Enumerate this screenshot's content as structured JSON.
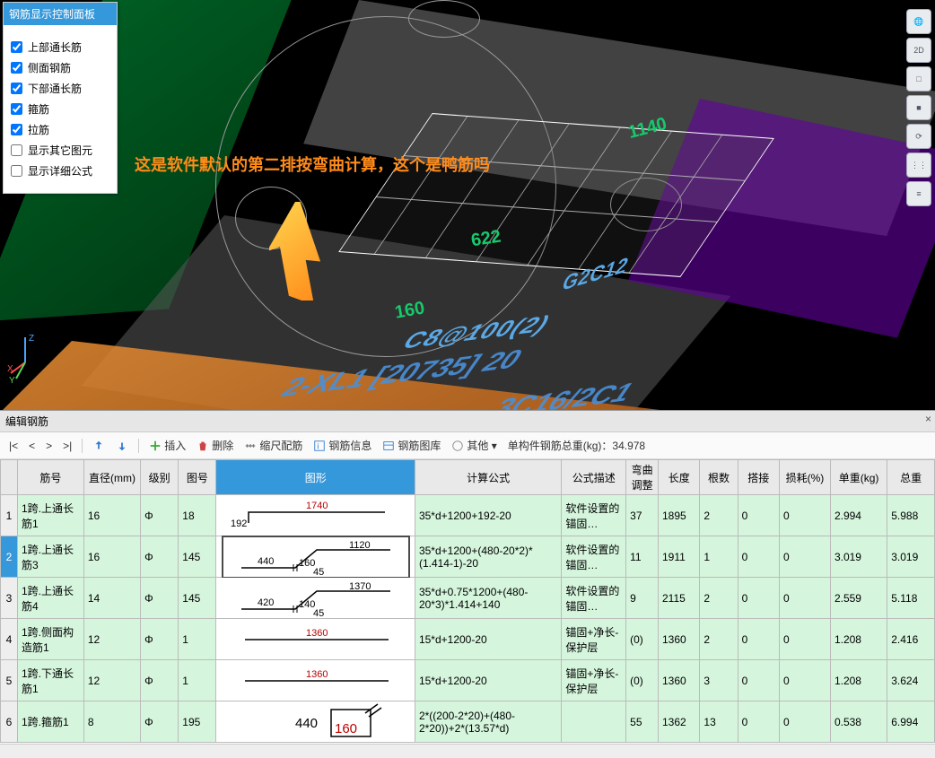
{
  "panel": {
    "title": "钢筋显示控制面板",
    "checks": [
      {
        "label": "上部通长筋",
        "checked": true
      },
      {
        "label": "侧面钢筋",
        "checked": true
      },
      {
        "label": "下部通长筋",
        "checked": true
      },
      {
        "label": "箍筋",
        "checked": true
      },
      {
        "label": "拉筋",
        "checked": true
      },
      {
        "label": "显示其它图元",
        "checked": false
      },
      {
        "label": "显示详细公式",
        "checked": false
      }
    ]
  },
  "right_tools": [
    {
      "name": "orbit-icon",
      "glyph": "🌐"
    },
    {
      "name": "view-2d-icon",
      "glyph": "2D"
    },
    {
      "name": "cube-wire-icon",
      "glyph": "□"
    },
    {
      "name": "cube-solid-icon",
      "glyph": "■"
    },
    {
      "name": "rotate-icon",
      "glyph": "⟳"
    },
    {
      "name": "tool-a-icon",
      "glyph": "⋮⋮"
    },
    {
      "name": "tool-b-icon",
      "glyph": "≡"
    }
  ],
  "axes": {
    "x": "X",
    "y": "Y",
    "z": "Z"
  },
  "scene": {
    "annotation": "这是软件默认的第二排按弯曲计算，这个是鸭筋吗",
    "dim1": "1140",
    "dim2": "622",
    "dim3": "160",
    "labelA": "C8@100(2)",
    "labelB": "G2C12",
    "labelC": "2-XL1 [20735] 20",
    "labelD": "3C16/2C1"
  },
  "lower": {
    "title": "编辑钢筋",
    "nav": {
      "first": "|<",
      "prev": "<",
      "next": ">",
      "last": ">|"
    },
    "btns": {
      "insert": "插入",
      "delete": "删除",
      "scale": "缩尺配筋",
      "info": "钢筋信息",
      "lib": "钢筋图库",
      "other": "其他 ▾"
    },
    "total_label": "单构件钢筋总重(kg)：",
    "total_value": "34.978",
    "columns": [
      "",
      "筋号",
      "直径(mm)",
      "级别",
      "图号",
      "图形",
      "计算公式",
      "公式描述",
      "弯曲调整",
      "长度",
      "根数",
      "搭接",
      "损耗(%)",
      "单重(kg)",
      "总重"
    ],
    "rows": [
      {
        "n": "1",
        "name": "1跨.上通长筋1",
        "dia": "16",
        "grade": "Φ",
        "code": "18",
        "shape": {
          "type": "hook-line",
          "a": "192",
          "b": "1740"
        },
        "formula": "35*d+1200+192-20",
        "desc": "软件设置的锚固…",
        "bend": "37",
        "len": "1895",
        "cnt": "2",
        "lap": "0",
        "loss": "0",
        "uw": "2.994",
        "tw": "5.988"
      },
      {
        "n": "2",
        "name": "1跨.上通长筋3",
        "dia": "16",
        "grade": "Φ",
        "code": "145",
        "selected": true,
        "shape": {
          "type": "zigzag",
          "a": "440",
          "b": "160",
          "c": "45",
          "d": "1120"
        },
        "formula": "35*d+1200+(480-20*2)*(1.414-1)-20",
        "desc": "软件设置的锚固…",
        "bend": "11",
        "len": "1911",
        "cnt": "1",
        "lap": "0",
        "loss": "0",
        "uw": "3.019",
        "tw": "3.019"
      },
      {
        "n": "3",
        "name": "1跨.上通长筋4",
        "dia": "14",
        "grade": "Φ",
        "code": "145",
        "shape": {
          "type": "zigzag",
          "a": "420",
          "b": "140",
          "c": "45",
          "d": "1370"
        },
        "formula": "35*d+0.75*1200+(480-20*3)*1.414+140",
        "desc": "软件设置的锚固…",
        "bend": "9",
        "len": "2115",
        "cnt": "2",
        "lap": "0",
        "loss": "0",
        "uw": "2.559",
        "tw": "5.118"
      },
      {
        "n": "4",
        "name": "1跨.侧面构造筋1",
        "dia": "12",
        "grade": "Φ",
        "code": "1",
        "shape": {
          "type": "line",
          "a": "1360"
        },
        "formula": "15*d+1200-20",
        "desc": "锚固+净长-保护层",
        "bend": "(0)",
        "len": "1360",
        "cnt": "2",
        "lap": "0",
        "loss": "0",
        "uw": "1.208",
        "tw": "2.416"
      },
      {
        "n": "5",
        "name": "1跨.下通长筋1",
        "dia": "12",
        "grade": "Φ",
        "code": "1",
        "shape": {
          "type": "line",
          "a": "1360"
        },
        "formula": "15*d+1200-20",
        "desc": "锚固+净长-保护层",
        "bend": "(0)",
        "len": "1360",
        "cnt": "3",
        "lap": "0",
        "loss": "0",
        "uw": "1.208",
        "tw": "3.624"
      },
      {
        "n": "6",
        "name": "1跨.箍筋1",
        "dia": "8",
        "grade": "Φ",
        "code": "195",
        "shape": {
          "type": "stirrup",
          "a": "440",
          "b": "160"
        },
        "formula": "2*((200-2*20)+(480-2*20))+2*(13.57*d)",
        "desc": "",
        "bend": "55",
        "len": "1362",
        "cnt": "13",
        "lap": "0",
        "loss": "0",
        "uw": "0.538",
        "tw": "6.994"
      }
    ]
  }
}
